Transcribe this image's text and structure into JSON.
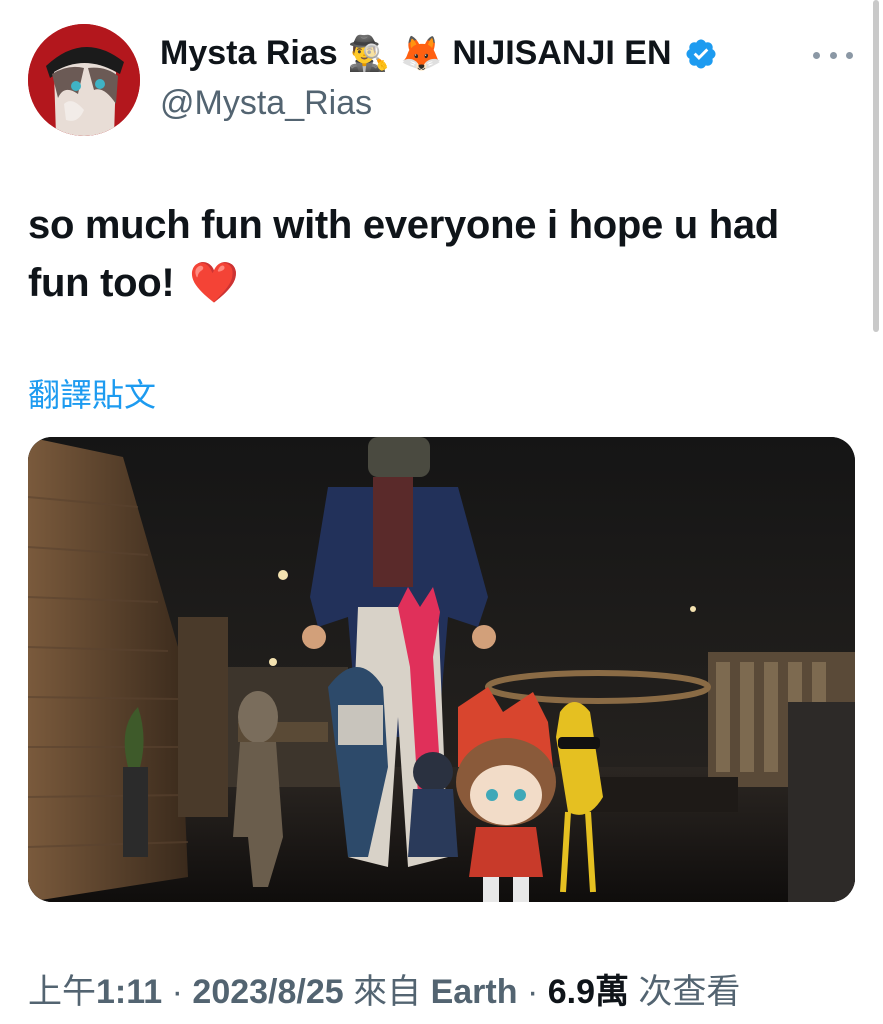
{
  "header": {
    "display_name": "Mysta Rias",
    "emoji_1": "🕵️‍♂️",
    "emoji_2": "🦊",
    "affiliation": "NIJISANJI EN",
    "handle": "@Mysta_Rias",
    "verified_icon": "verified-badge-icon",
    "more_icon": "more-options-icon"
  },
  "tweet": {
    "text": "so much fun with everyone i hope u had fun too!",
    "emoji": "❤️",
    "translate_label": "翻譯貼文"
  },
  "meta": {
    "time_prefix": "上午",
    "time": "1:11",
    "sep1": " · ",
    "date": "2023/8/25",
    "source_prefix": " 來自 ",
    "source": "Earth",
    "sep2": " · ",
    "views": "6.9萬",
    "views_label": " 次查看"
  },
  "colors": {
    "link": "#1d9bf0",
    "secondary": "#536471",
    "verified": "#1d9bf0",
    "heart": "#e0245e"
  }
}
